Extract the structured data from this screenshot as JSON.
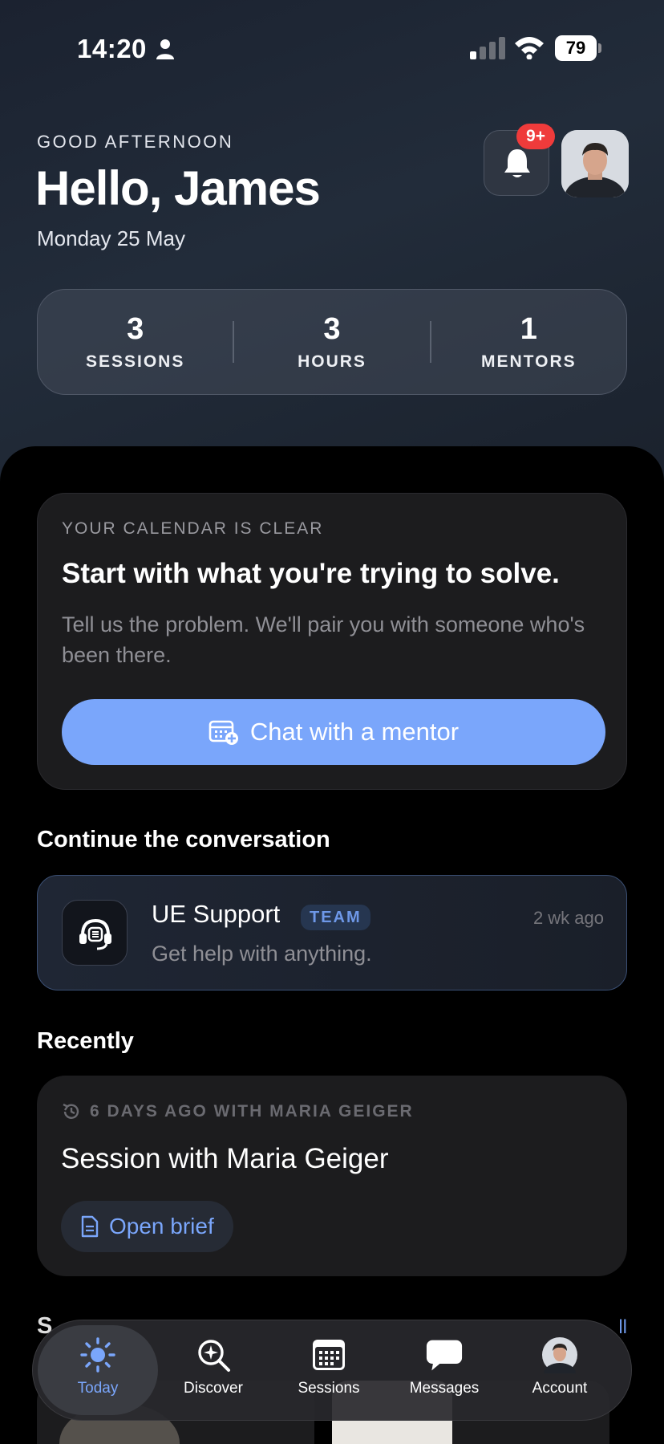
{
  "status_bar": {
    "time": "14:20",
    "battery": "79"
  },
  "header": {
    "eyebrow": "GOOD AFTERNOON",
    "title": "Hello, James",
    "date": "Monday 25 May",
    "notification_badge": "9+"
  },
  "stats": [
    {
      "value": "3",
      "label": "SESSIONS"
    },
    {
      "value": "3",
      "label": "HOURS"
    },
    {
      "value": "1",
      "label": "MENTORS"
    }
  ],
  "calendar_card": {
    "eyebrow": "YOUR CALENDAR IS CLEAR",
    "title": "Start with what you're trying to solve.",
    "description": "Tell us the problem. We'll pair you with someone who's been there.",
    "cta_label": "Chat with a mentor"
  },
  "continue_section": {
    "heading": "Continue the conversation",
    "conversation": {
      "name": "UE Support",
      "tag": "TEAM",
      "time": "2 wk ago",
      "subtitle": "Get help with anything."
    }
  },
  "recently_section": {
    "heading": "Recently",
    "eyebrow": "6 DAYS AGO WITH MARIA GEIGER",
    "title": "Session with Maria Geiger",
    "button_label": "Open brief"
  },
  "peek_section": {
    "heading_partial": "S",
    "link_partial": "ll"
  },
  "tabbar": {
    "tabs": [
      {
        "label": "Today",
        "icon": "sun-icon",
        "active": true
      },
      {
        "label": "Discover",
        "icon": "discover-search-icon",
        "active": false
      },
      {
        "label": "Sessions",
        "icon": "calendar-grid-icon",
        "active": false
      },
      {
        "label": "Messages",
        "icon": "chat-bubble-icon",
        "active": false
      },
      {
        "label": "Account",
        "icon": "account-avatar-icon",
        "active": false
      }
    ]
  },
  "colors": {
    "accent": "#7aa6fb",
    "badge": "#ef3b3b",
    "card": "#1c1c1e",
    "background": "#000000"
  }
}
